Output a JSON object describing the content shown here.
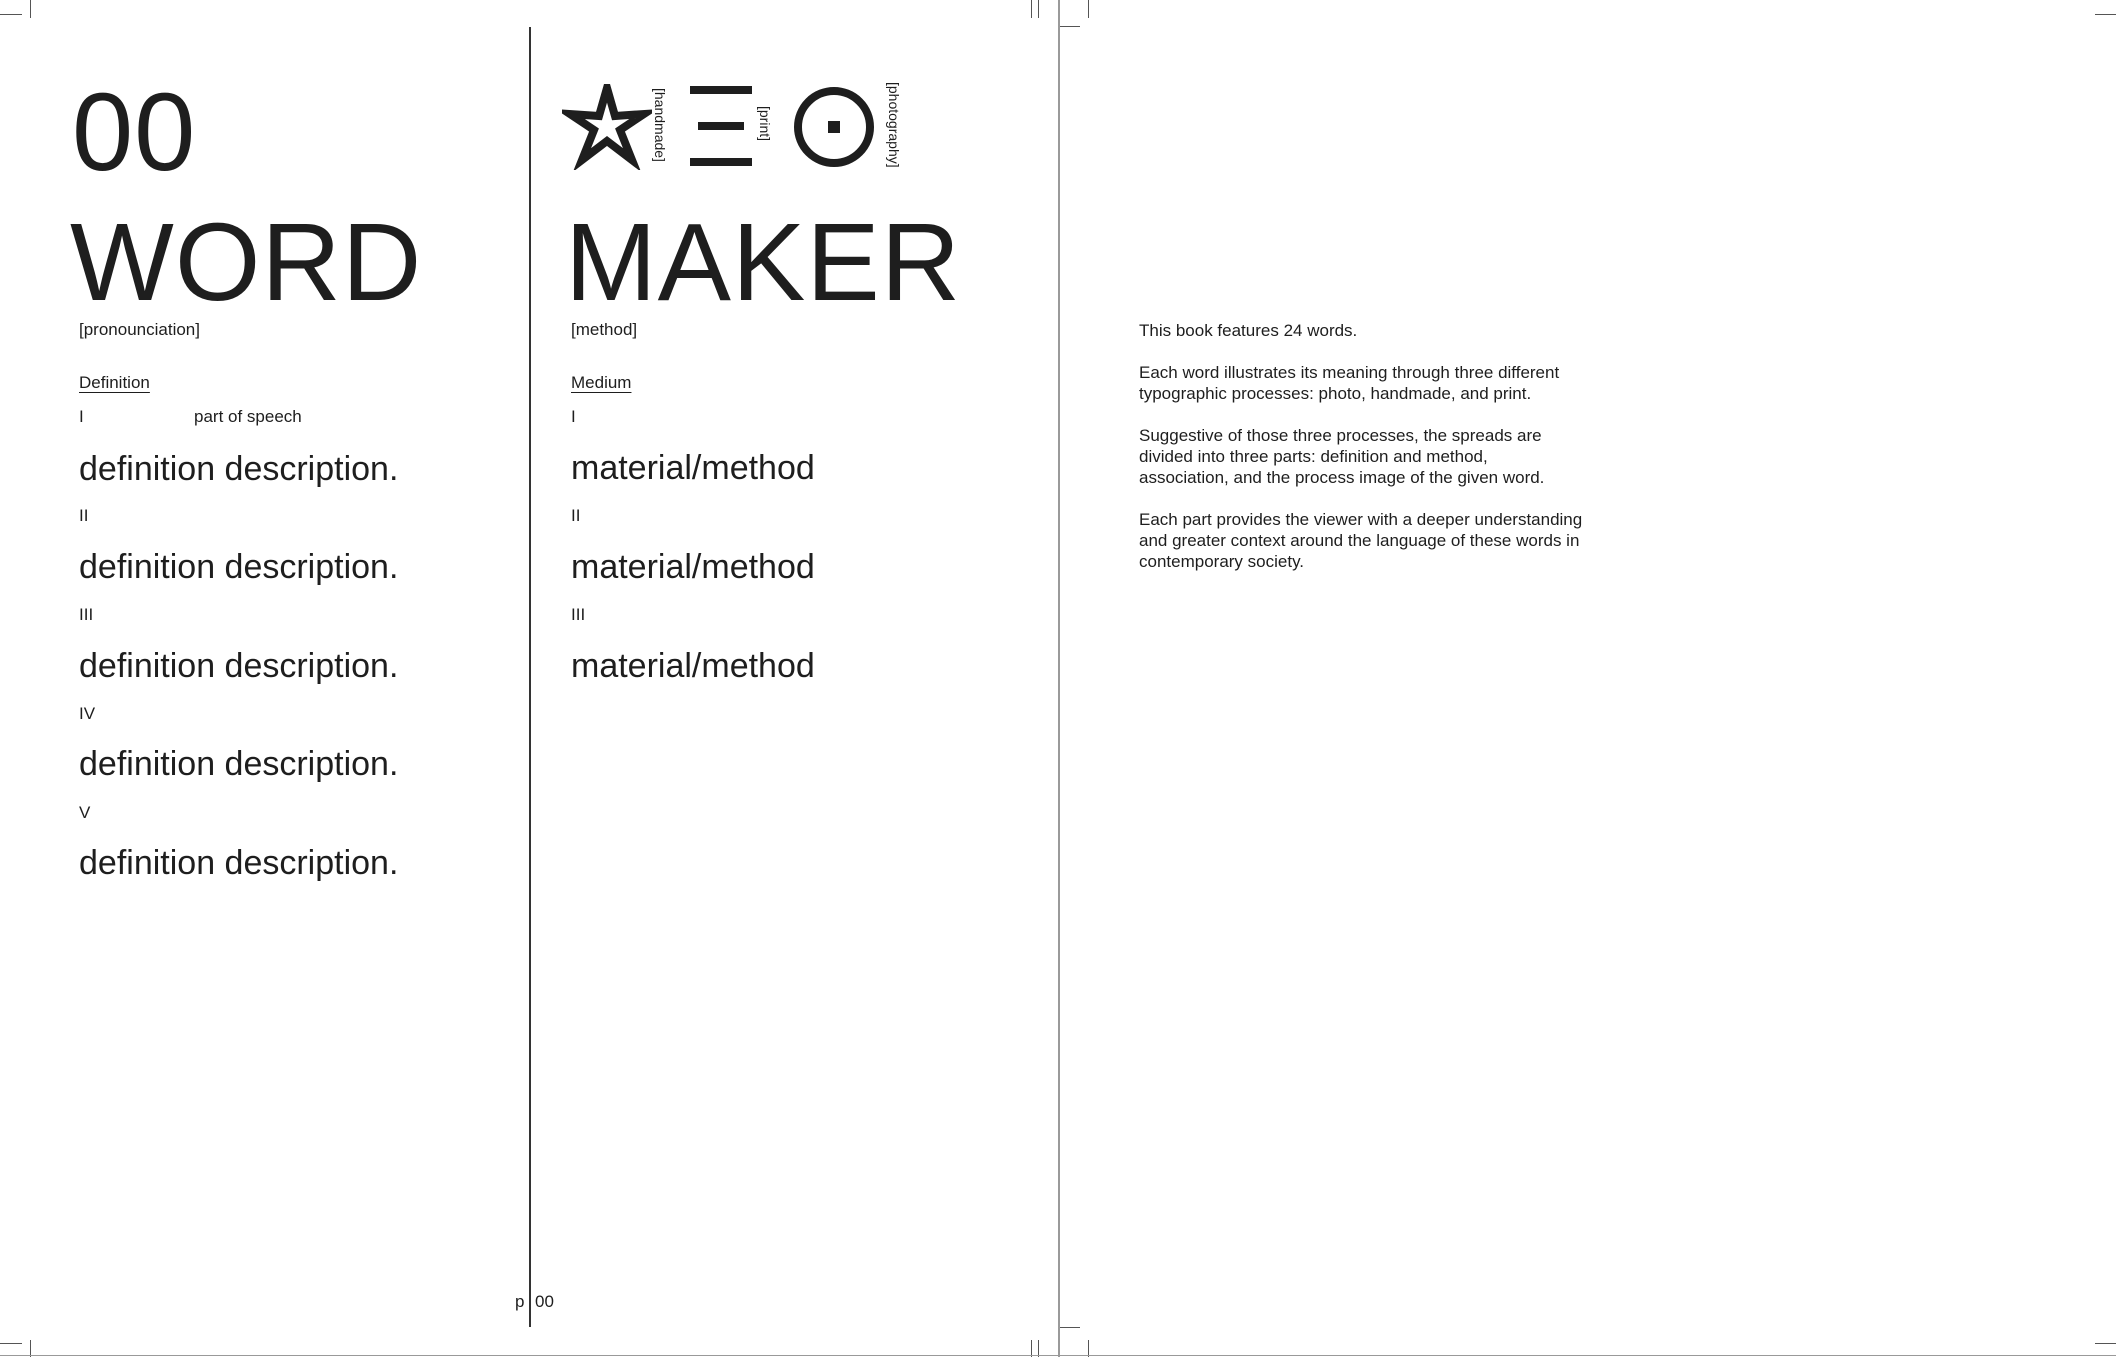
{
  "left_page": {
    "number": "00",
    "word": "WORD",
    "pronunciation": "[pronounciation]",
    "definition_heading": "Definition",
    "part_of_speech": "part of speech",
    "definitions": [
      {
        "numeral": "I",
        "text": "definition description."
      },
      {
        "numeral": "II",
        "text": "definition description."
      },
      {
        "numeral": "III",
        "text": "definition description."
      },
      {
        "numeral": "IV",
        "text": "definition description."
      },
      {
        "numeral": "V",
        "text": "definition description."
      }
    ],
    "folio_p": "p",
    "folio_num": "00"
  },
  "middle_page": {
    "icons": [
      {
        "name": "asterisk-icon",
        "label": "[handmade]"
      },
      {
        "name": "xi-icon",
        "label": "[print]"
      },
      {
        "name": "theta-icon",
        "label": "[photography]"
      }
    ],
    "maker": "MAKER",
    "method": "[method]",
    "medium_heading": "Medium",
    "materials": [
      {
        "numeral": "I",
        "text": "material/method"
      },
      {
        "numeral": "II",
        "text": "material/method"
      },
      {
        "numeral": "III",
        "text": "material/method"
      }
    ]
  },
  "right_page": {
    "paragraphs": [
      "This book features 24 words.",
      "Each word illustrates its meaning through three different typographic processes: photo, handmade, and print.",
      "Suggestive of those three processes, the spreads are divided into three parts: definition and method, association, and the process image of the given word.",
      "Each part provides the viewer with a deeper understanding and greater context around the language of these words in contemporary society."
    ]
  },
  "colors": {
    "ink": "#1e1e1e",
    "paper": "#ffffff"
  }
}
